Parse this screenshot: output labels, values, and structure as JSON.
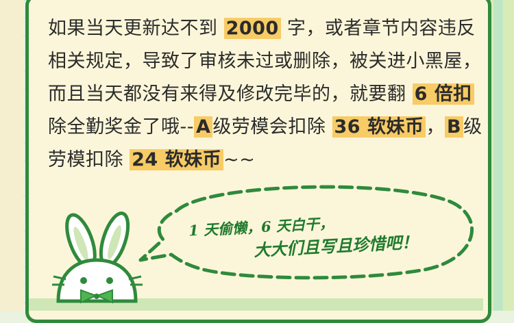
{
  "paragraph": {
    "line1": {
      "pre": "如果当天更新达不到 ",
      "hl": "2000",
      "post": " 字，或者章节内容违反"
    },
    "line2": {
      "text": "相关规定，导致了审核未过或删除，被关进小黑屋，"
    },
    "line3": {
      "pre": "而且当天都没有来得及修改完毕的，就要翻 ",
      "hl": "6 倍扣"
    },
    "line4": {
      "pre": "除全勤奖金了哦--",
      "hl1": "A",
      "mid1": "级劳模会扣除 ",
      "hl2": "36 软妹币",
      "mid2": "，",
      "hl3": "B",
      "post": "级"
    },
    "line5": {
      "pre": "劳模扣除 ",
      "hl": "24 软妹币",
      "post": "~~"
    }
  },
  "bubble": {
    "line1": "1 天偷懒，6 天白干，",
    "line2": "大大们且写且珍惜吧！"
  },
  "colors": {
    "highlight": "#f7cb66",
    "border_green": "#2f8a3c",
    "card_bg": "#fbf6d9",
    "bubble_dash": "#2f8a3c"
  },
  "icons": [
    "bunny-mascot-icon",
    "green-bowtie-icon"
  ]
}
